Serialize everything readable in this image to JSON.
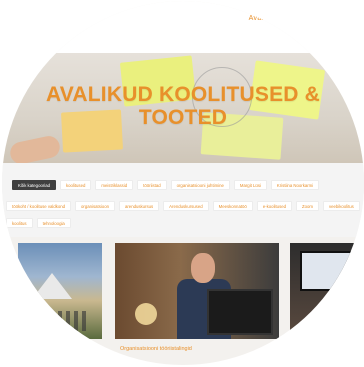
{
  "header": {
    "top_link": "Avaleht"
  },
  "hero": {
    "title": "AVALIKUD KOOLITUSED & TOOTED"
  },
  "filters": {
    "row1": [
      {
        "label": "Kõik kategooriad",
        "active": true
      },
      {
        "label": "koolitused",
        "active": false
      },
      {
        "label": "meistriklassid",
        "active": false
      },
      {
        "label": "tööriistad",
        "active": false
      },
      {
        "label": "organisatsiooni juhtimine",
        "active": false
      },
      {
        "label": "Margit Lüsi",
        "active": false
      },
      {
        "label": "Kristiina Noorkarmi",
        "active": false
      }
    ],
    "row2": [
      {
        "label": "töökoht / koolituse valdkond",
        "active": false
      },
      {
        "label": "organisatsioon",
        "active": false
      },
      {
        "label": "arenduskursus",
        "active": false
      },
      {
        "label": "Arenduskursused",
        "active": false
      },
      {
        "label": "Meeskonnatöö",
        "active": false
      },
      {
        "label": "e-koolitused",
        "active": false
      },
      {
        "label": "Zoom",
        "active": false
      },
      {
        "label": "veebikoolitus",
        "active": false
      }
    ],
    "row3": [
      {
        "label": "koolitus",
        "active": false
      },
      {
        "label": "tehnoloogia",
        "active": false
      }
    ]
  },
  "gallery": {
    "caption": "Organisatsiooni tööriistalingid"
  },
  "colors": {
    "accent": "#e8902b",
    "active_tag_bg": "#3f3f3f"
  }
}
